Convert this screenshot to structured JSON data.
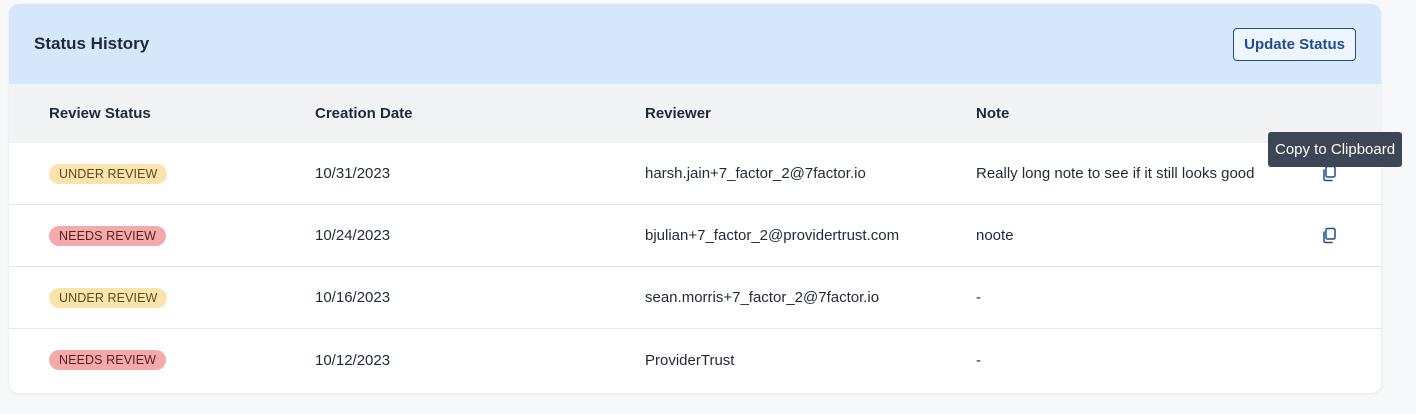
{
  "header": {
    "title": "Status History",
    "update_button": "Update Status"
  },
  "columns": {
    "review_status": "Review Status",
    "creation_date": "Creation Date",
    "reviewer": "Reviewer",
    "note": "Note"
  },
  "rows": [
    {
      "status": "UNDER REVIEW",
      "date": "10/31/2023",
      "reviewer": "harsh.jain+7_factor_2@7factor.io",
      "note": "Really long note to see if it still looks good",
      "copyable": true
    },
    {
      "status": "NEEDS REVIEW",
      "date": "10/24/2023",
      "reviewer": "bjulian+7_factor_2@providertrust.com",
      "note": "noote",
      "copyable": true
    },
    {
      "status": "UNDER REVIEW",
      "date": "10/16/2023",
      "reviewer": "sean.morris+7_factor_2@7factor.io",
      "note": "-",
      "copyable": false
    },
    {
      "status": "NEEDS REVIEW",
      "date": "10/12/2023",
      "reviewer": "ProviderTrust",
      "note": "-",
      "copyable": false
    }
  ],
  "tooltip": {
    "text": "Copy to Clipboard"
  },
  "icons": {
    "copy": "copy-icon"
  },
  "colors": {
    "header_bg": "#d6e7fb",
    "accent": "#1f4e8c",
    "under_review_badge": "#fbe3ad",
    "needs_review_badge": "#f4a9ab",
    "tooltip_bg": "#3d4654"
  }
}
